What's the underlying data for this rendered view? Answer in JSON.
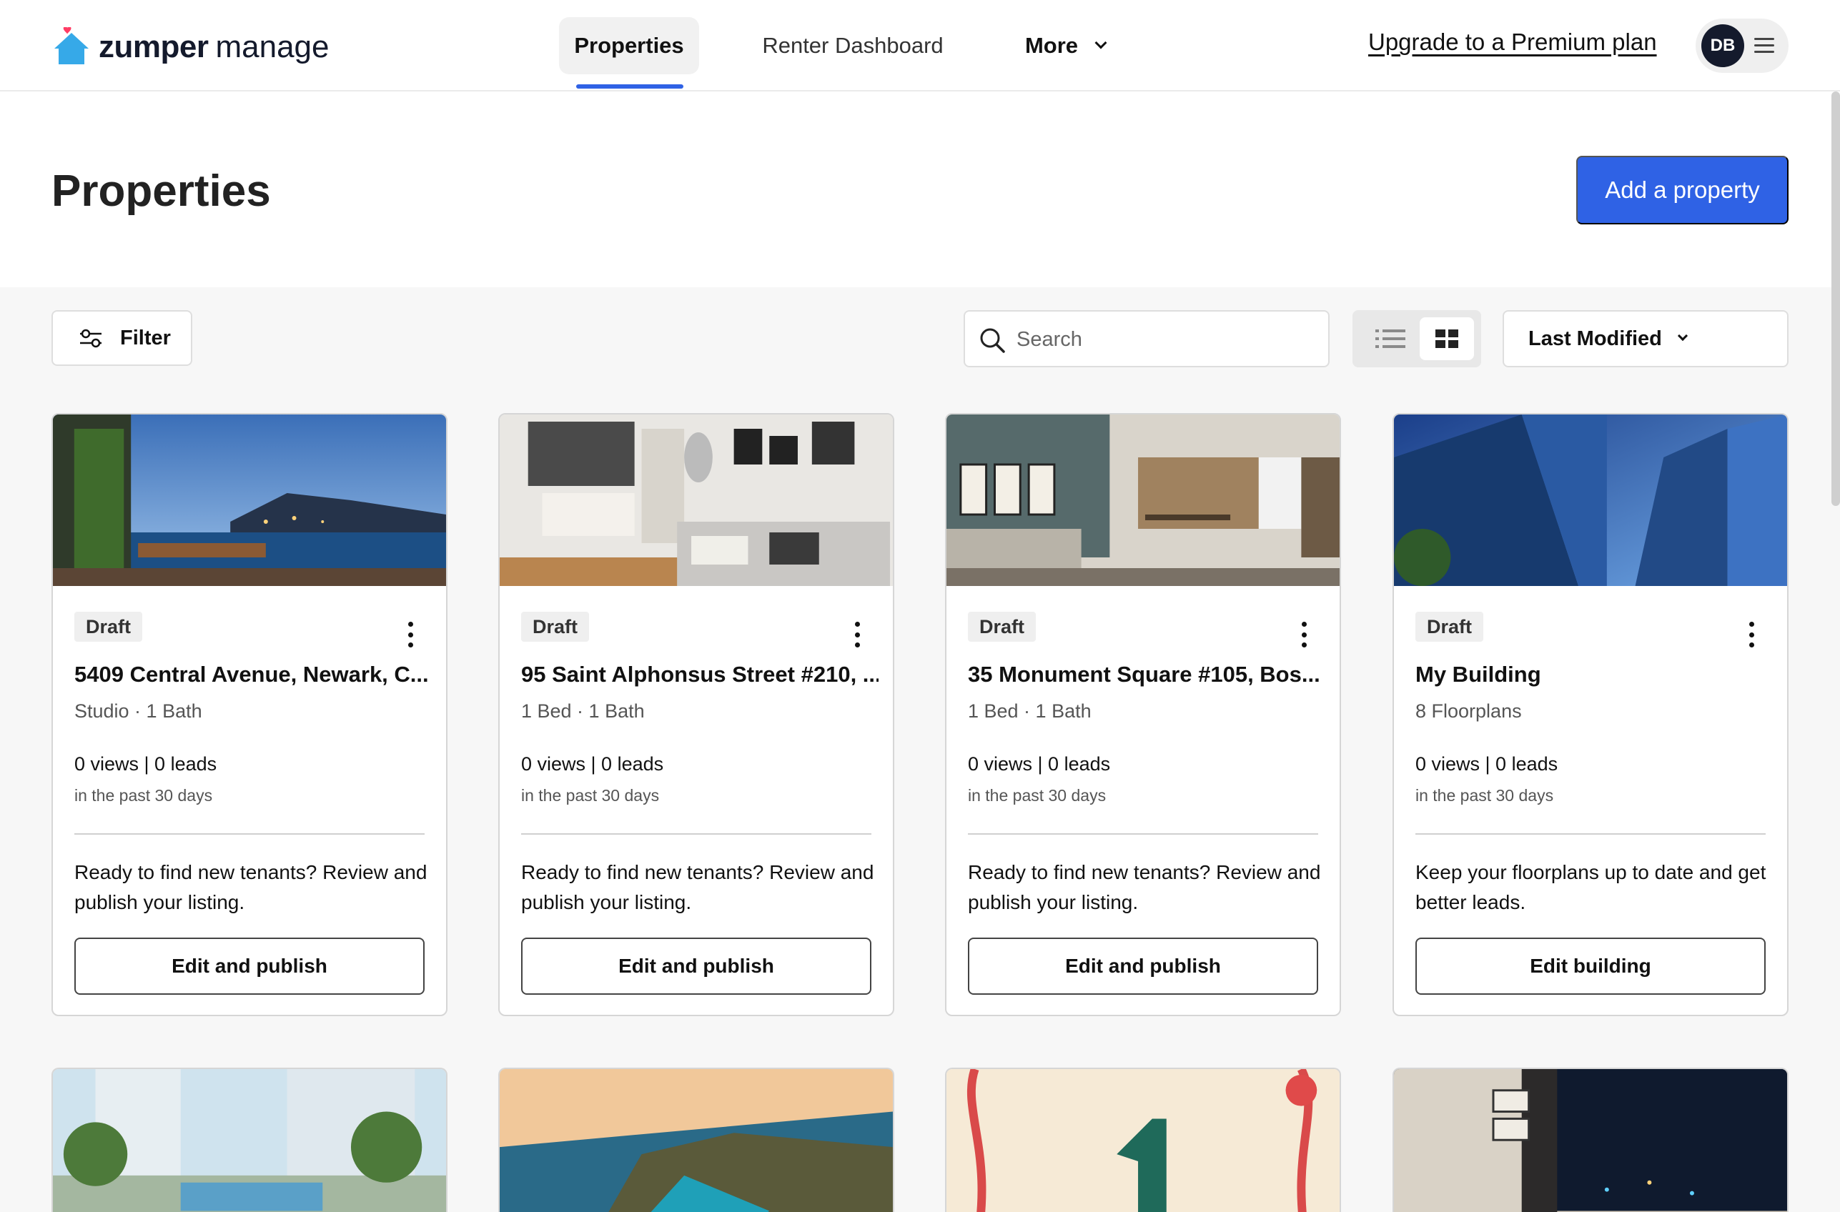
{
  "header": {
    "logo_primary": "zumper",
    "logo_secondary": "manage",
    "nav": [
      {
        "label": "Properties"
      },
      {
        "label": "Renter Dashboard"
      },
      {
        "label": "More"
      }
    ],
    "upgrade_link": "Upgrade to a Premium plan",
    "avatar_initials": "DB"
  },
  "page": {
    "title": "Properties",
    "add_button": "Add a property"
  },
  "toolbar": {
    "filter_label": "Filter",
    "search_placeholder": "Search",
    "sort_label": "Last Modified",
    "view_mode": "grid"
  },
  "cards": [
    {
      "status": "Draft",
      "title": "5409 Central Avenue, Newark, C...",
      "subtitle": "Studio · 1 Bath",
      "stats": "0 views | 0 leads",
      "period": "in the past 30 days",
      "message": "Ready to find new tenants? Review and publish your listing.",
      "action": "Edit and publish",
      "photo": "balcony-ocean-view-icon"
    },
    {
      "status": "Draft",
      "title": "95 Saint Alphonsus Street #210, ...",
      "subtitle": "1 Bed · 1 Bath",
      "stats": "0 views | 0 leads",
      "period": "in the past 30 days",
      "message": "Ready to find new tenants? Review and publish your listing.",
      "action": "Edit and publish",
      "photo": "living-room-icon"
    },
    {
      "status": "Draft",
      "title": "35 Monument Square #105, Bos...",
      "subtitle": "1 Bed · 1 Bath",
      "stats": "0 views | 0 leads",
      "period": "in the past 30 days",
      "message": "Ready to find new tenants? Review and publish your listing.",
      "action": "Edit and publish",
      "photo": "open-plan-apartment-icon"
    },
    {
      "status": "Draft",
      "title": "My Building",
      "subtitle": "8 Floorplans",
      "stats": "0 views | 0 leads",
      "period": "in the past 30 days",
      "message": "Keep your floorplans up to date and get better leads.",
      "action": "Edit building",
      "photo": "skyscrapers-icon"
    }
  ],
  "colors": {
    "primary": "#2f62e5",
    "navy": "#141a2c",
    "logo_blue": "#36a9e8",
    "logo_heart": "#ff3c64"
  }
}
